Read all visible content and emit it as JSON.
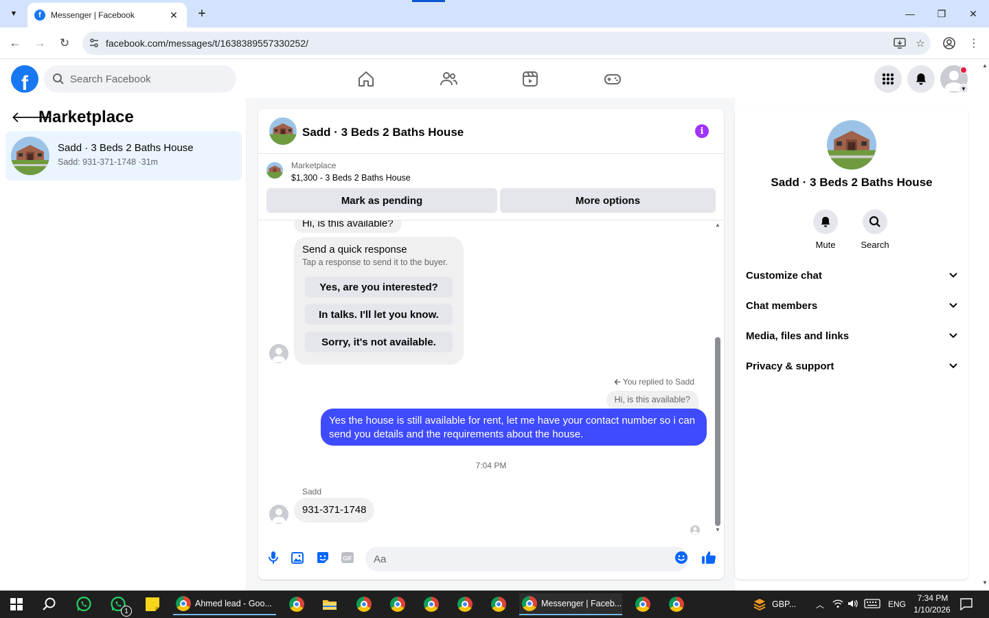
{
  "browser": {
    "tab_title": "Messenger | Facebook",
    "tab_favicon": "f",
    "url": "facebook.com/messages/t/1638389557330252/",
    "accent_color": "#d3e3fd"
  },
  "fb_header": {
    "logo_letter": "f",
    "search_placeholder": "Search Facebook",
    "brand_color": "#1877f2"
  },
  "sidebar": {
    "title": "Marketplace",
    "threads": [
      {
        "name": "Sadd · 3 Beds 2 Baths House",
        "preview": "Sadd: 931-371-1748 ·31m"
      }
    ]
  },
  "chat": {
    "title": "Sadd · 3 Beds 2 Baths House",
    "marketplace_label": "Marketplace",
    "listing": "$1,300 - 3 Beds 2 Baths House",
    "mark_pending_label": "Mark as pending",
    "more_options_label": "More options",
    "first_message": "Hi, is this available?",
    "quick_response": {
      "title": "Send a quick response",
      "subtitle": "Tap a response to send it to the buyer.",
      "options": [
        "Yes, are you interested?",
        "In talks. I'll let you know.",
        "Sorry, it's not available."
      ]
    },
    "reply_note": "You replied to Sadd",
    "reply_quote": "Hi, is this available?",
    "sent_message": "Yes the house is still available for rent, let me have your contact number so i can send you details and the requirements about the house.",
    "timestamp": "7:04 PM",
    "sender_name": "Sadd",
    "received_message": "931-371-1748",
    "composer_placeholder": "Aa",
    "sent_bubble_color": "#3f4bff"
  },
  "details": {
    "title": "Sadd · 3 Beds 2 Baths House",
    "actions": [
      {
        "label": "Mute",
        "icon": "bell-icon"
      },
      {
        "label": "Search",
        "icon": "search-icon"
      }
    ],
    "sections": [
      "Customize chat",
      "Chat members",
      "Media, files and links",
      "Privacy & support"
    ]
  },
  "taskbar": {
    "items": [
      "Ahmed lead - Goo...",
      "Messenger | Faceb..."
    ],
    "whatsapp_badge": "1",
    "tray_app": "GBP...",
    "language": "ENG",
    "time": "7:34 PM",
    "date": "1/10/2026"
  }
}
